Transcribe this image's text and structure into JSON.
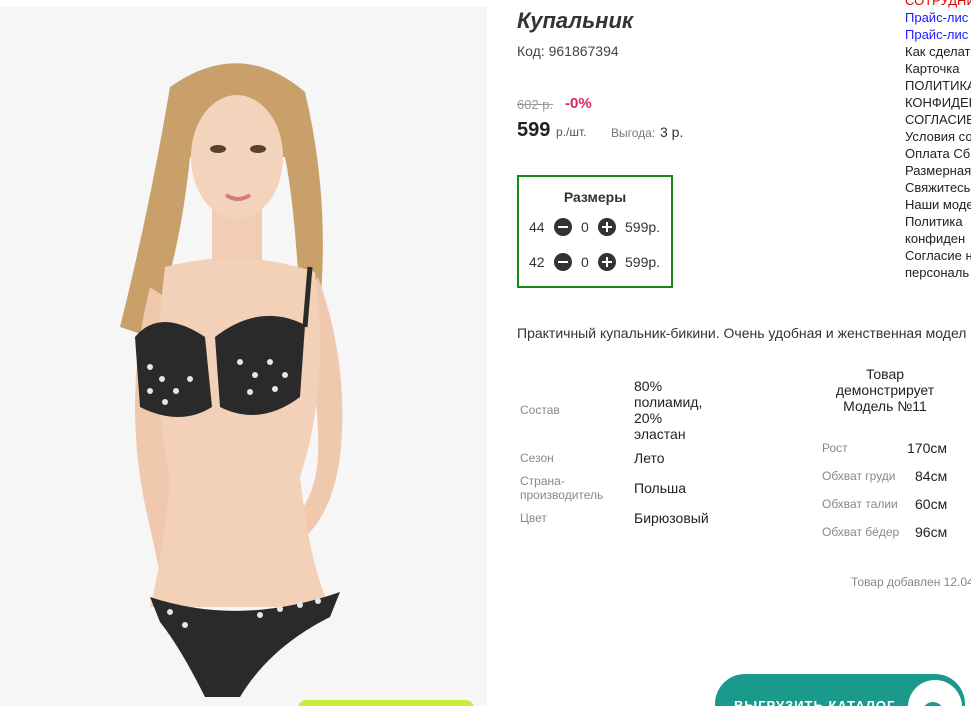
{
  "product": {
    "title": "Купальник",
    "code": "Код: 961867394",
    "old_price": "602 р.",
    "discount": "-0%",
    "price": "599",
    "price_unit": "р./шт.",
    "benefit_label": "Выгода:",
    "benefit_value": "3 р."
  },
  "sizes": {
    "title": "Размеры",
    "rows": [
      {
        "size": "44",
        "qty": "0",
        "price": "599р."
      },
      {
        "size": "42",
        "qty": "0",
        "price": "599р."
      }
    ]
  },
  "description": "Практичный купальник-бикини. Очень удобная и женственная модел",
  "specs": [
    {
      "label": "Состав",
      "value_lines": [
        "80%",
        "полиамид,",
        "20%",
        "эластан"
      ]
    },
    {
      "label": "Сезон",
      "value": "Лето"
    },
    {
      "label_lines": [
        "Страна-",
        "производитель"
      ],
      "value": "Польша"
    },
    {
      "label": "Цвет",
      "value": "Бирюзовый"
    }
  ],
  "model": {
    "heading_lines": [
      "Товар",
      "демонстрирует",
      "Модель №11"
    ],
    "params": [
      {
        "label": "Рост",
        "value": "170см"
      },
      {
        "label": "Обхват груди",
        "value": "84см"
      },
      {
        "label": "Обхват талии",
        "value": "60см"
      },
      {
        "label": "Обхват бёдер",
        "value": "96см"
      }
    ]
  },
  "added_text": "Товар добавлен 12.04",
  "side_links": [
    "СОТРУДНИ",
    "Прайс-лис",
    "Прайс-лис",
    "Как сделат",
    "Карточка",
    "ПОЛИТИКА",
    "КОНФИДЕН",
    "СОГЛАСИЕ",
    "Условия со",
    "Оплата Сб",
    "Размерная",
    "Свяжитесь",
    "Наши моде",
    "Политика",
    "конфиден",
    "Согласие н",
    "персональ"
  ],
  "catalog_button": "ВЫГРУЗИТЬ КАТАЛОГ",
  "colors": {
    "sizes_border": "#148a14",
    "discount": "#e0245e",
    "catalog_button": "#1a9a8c",
    "side_link_red": "#e00000",
    "side_link_blue": "#1a1aff"
  }
}
